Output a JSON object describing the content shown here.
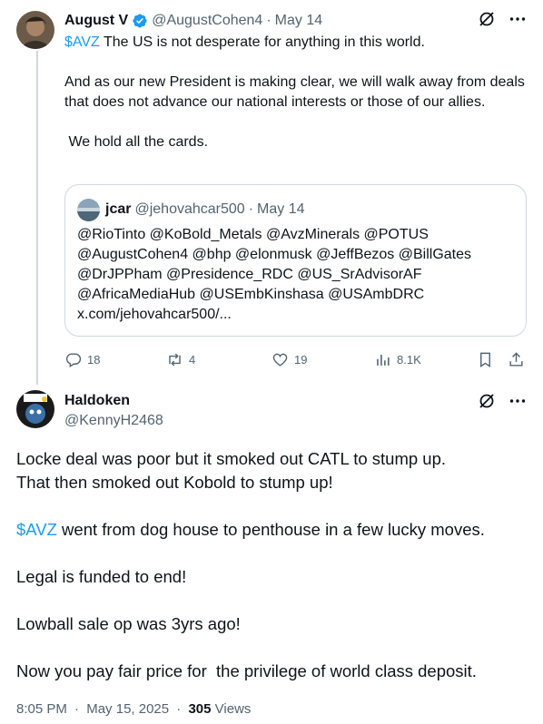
{
  "tweet1": {
    "author_name": "August V",
    "handle": "@AugustCohen4",
    "date": "May 14",
    "lines": [
      {
        "cashtag": "$AVZ",
        "text": " The US is not desperate for anything in this world."
      },
      {
        "text": "And as our new President is making clear, we will walk away from deals that does not advance our national interests or those of our allies."
      },
      {
        "text": " We hold all the cards."
      }
    ],
    "quote": {
      "author_name": "jcar",
      "handle": "@jehovahcar500",
      "date": "May 14",
      "text": "@RioTinto @KoBold_Metals @AvzMinerals @POTUS @AugustCohen4  @bhp @elonmusk @JeffBezos @BillGates @DrJPPham @Presidence_RDC @US_SrAdvisorAF @AfricaMediaHub @USEmbKinshasa @USAmbDRC x.com/jehovahcar500/..."
    },
    "stats": {
      "replies": "18",
      "reposts": "4",
      "likes": "19",
      "views": "8.1K"
    }
  },
  "tweet2": {
    "author_name": "Haldoken",
    "handle": "@KennyH2468",
    "paragraphs": [
      {
        "lines": [
          "Locke deal was poor but it smoked out CATL to stump up.",
          "That then smoked out Kobold to stump up!"
        ]
      },
      {
        "cashtag": "$AVZ",
        "text": " went from dog house to penthouse in a few lucky moves."
      },
      {
        "text": "Legal is funded to end!"
      },
      {
        "text": "Lowball sale op was 3yrs ago!"
      },
      {
        "text": "Now you pay fair price for  the privilege of world class deposit."
      }
    ],
    "time": "8:05 PM",
    "date": "May 15, 2025",
    "views_count": "305",
    "views_label": "Views"
  },
  "icons": {
    "verified": "verified-badge-icon",
    "grok": "grok-icon",
    "more": "more-icon",
    "reply": "reply-icon",
    "repost": "repost-icon",
    "like": "heart-icon",
    "views": "views-icon",
    "bookmark": "bookmark-icon",
    "share": "share-icon"
  },
  "colors": {
    "accent": "#1d9bf0",
    "text": "#0f1419",
    "muted": "#536471",
    "border": "#cfd9de"
  }
}
